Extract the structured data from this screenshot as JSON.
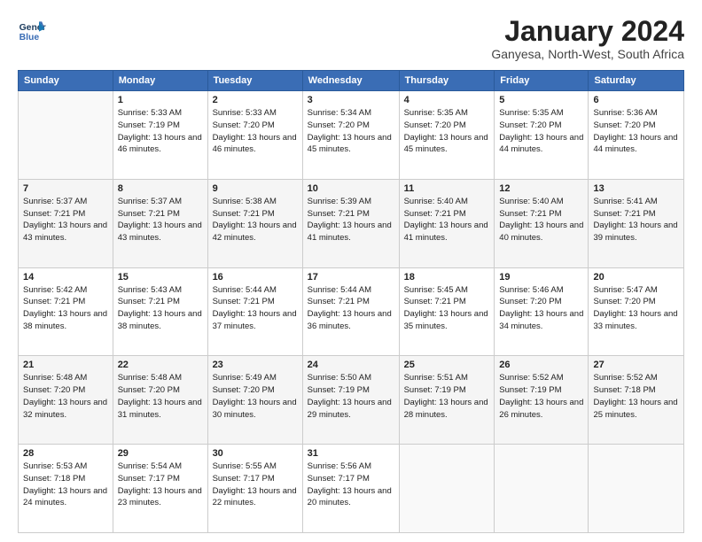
{
  "header": {
    "logo_line1": "General",
    "logo_line2": "Blue",
    "month": "January 2024",
    "location": "Ganyesa, North-West, South Africa"
  },
  "days_of_week": [
    "Sunday",
    "Monday",
    "Tuesday",
    "Wednesday",
    "Thursday",
    "Friday",
    "Saturday"
  ],
  "weeks": [
    [
      {
        "num": "",
        "sunrise": "",
        "sunset": "",
        "daylight": ""
      },
      {
        "num": "1",
        "sunrise": "Sunrise: 5:33 AM",
        "sunset": "Sunset: 7:19 PM",
        "daylight": "Daylight: 13 hours and 46 minutes."
      },
      {
        "num": "2",
        "sunrise": "Sunrise: 5:33 AM",
        "sunset": "Sunset: 7:20 PM",
        "daylight": "Daylight: 13 hours and 46 minutes."
      },
      {
        "num": "3",
        "sunrise": "Sunrise: 5:34 AM",
        "sunset": "Sunset: 7:20 PM",
        "daylight": "Daylight: 13 hours and 45 minutes."
      },
      {
        "num": "4",
        "sunrise": "Sunrise: 5:35 AM",
        "sunset": "Sunset: 7:20 PM",
        "daylight": "Daylight: 13 hours and 45 minutes."
      },
      {
        "num": "5",
        "sunrise": "Sunrise: 5:35 AM",
        "sunset": "Sunset: 7:20 PM",
        "daylight": "Daylight: 13 hours and 44 minutes."
      },
      {
        "num": "6",
        "sunrise": "Sunrise: 5:36 AM",
        "sunset": "Sunset: 7:20 PM",
        "daylight": "Daylight: 13 hours and 44 minutes."
      }
    ],
    [
      {
        "num": "7",
        "sunrise": "Sunrise: 5:37 AM",
        "sunset": "Sunset: 7:21 PM",
        "daylight": "Daylight: 13 hours and 43 minutes."
      },
      {
        "num": "8",
        "sunrise": "Sunrise: 5:37 AM",
        "sunset": "Sunset: 7:21 PM",
        "daylight": "Daylight: 13 hours and 43 minutes."
      },
      {
        "num": "9",
        "sunrise": "Sunrise: 5:38 AM",
        "sunset": "Sunset: 7:21 PM",
        "daylight": "Daylight: 13 hours and 42 minutes."
      },
      {
        "num": "10",
        "sunrise": "Sunrise: 5:39 AM",
        "sunset": "Sunset: 7:21 PM",
        "daylight": "Daylight: 13 hours and 41 minutes."
      },
      {
        "num": "11",
        "sunrise": "Sunrise: 5:40 AM",
        "sunset": "Sunset: 7:21 PM",
        "daylight": "Daylight: 13 hours and 41 minutes."
      },
      {
        "num": "12",
        "sunrise": "Sunrise: 5:40 AM",
        "sunset": "Sunset: 7:21 PM",
        "daylight": "Daylight: 13 hours and 40 minutes."
      },
      {
        "num": "13",
        "sunrise": "Sunrise: 5:41 AM",
        "sunset": "Sunset: 7:21 PM",
        "daylight": "Daylight: 13 hours and 39 minutes."
      }
    ],
    [
      {
        "num": "14",
        "sunrise": "Sunrise: 5:42 AM",
        "sunset": "Sunset: 7:21 PM",
        "daylight": "Daylight: 13 hours and 38 minutes."
      },
      {
        "num": "15",
        "sunrise": "Sunrise: 5:43 AM",
        "sunset": "Sunset: 7:21 PM",
        "daylight": "Daylight: 13 hours and 38 minutes."
      },
      {
        "num": "16",
        "sunrise": "Sunrise: 5:44 AM",
        "sunset": "Sunset: 7:21 PM",
        "daylight": "Daylight: 13 hours and 37 minutes."
      },
      {
        "num": "17",
        "sunrise": "Sunrise: 5:44 AM",
        "sunset": "Sunset: 7:21 PM",
        "daylight": "Daylight: 13 hours and 36 minutes."
      },
      {
        "num": "18",
        "sunrise": "Sunrise: 5:45 AM",
        "sunset": "Sunset: 7:21 PM",
        "daylight": "Daylight: 13 hours and 35 minutes."
      },
      {
        "num": "19",
        "sunrise": "Sunrise: 5:46 AM",
        "sunset": "Sunset: 7:20 PM",
        "daylight": "Daylight: 13 hours and 34 minutes."
      },
      {
        "num": "20",
        "sunrise": "Sunrise: 5:47 AM",
        "sunset": "Sunset: 7:20 PM",
        "daylight": "Daylight: 13 hours and 33 minutes."
      }
    ],
    [
      {
        "num": "21",
        "sunrise": "Sunrise: 5:48 AM",
        "sunset": "Sunset: 7:20 PM",
        "daylight": "Daylight: 13 hours and 32 minutes."
      },
      {
        "num": "22",
        "sunrise": "Sunrise: 5:48 AM",
        "sunset": "Sunset: 7:20 PM",
        "daylight": "Daylight: 13 hours and 31 minutes."
      },
      {
        "num": "23",
        "sunrise": "Sunrise: 5:49 AM",
        "sunset": "Sunset: 7:20 PM",
        "daylight": "Daylight: 13 hours and 30 minutes."
      },
      {
        "num": "24",
        "sunrise": "Sunrise: 5:50 AM",
        "sunset": "Sunset: 7:19 PM",
        "daylight": "Daylight: 13 hours and 29 minutes."
      },
      {
        "num": "25",
        "sunrise": "Sunrise: 5:51 AM",
        "sunset": "Sunset: 7:19 PM",
        "daylight": "Daylight: 13 hours and 28 minutes."
      },
      {
        "num": "26",
        "sunrise": "Sunrise: 5:52 AM",
        "sunset": "Sunset: 7:19 PM",
        "daylight": "Daylight: 13 hours and 26 minutes."
      },
      {
        "num": "27",
        "sunrise": "Sunrise: 5:52 AM",
        "sunset": "Sunset: 7:18 PM",
        "daylight": "Daylight: 13 hours and 25 minutes."
      }
    ],
    [
      {
        "num": "28",
        "sunrise": "Sunrise: 5:53 AM",
        "sunset": "Sunset: 7:18 PM",
        "daylight": "Daylight: 13 hours and 24 minutes."
      },
      {
        "num": "29",
        "sunrise": "Sunrise: 5:54 AM",
        "sunset": "Sunset: 7:17 PM",
        "daylight": "Daylight: 13 hours and 23 minutes."
      },
      {
        "num": "30",
        "sunrise": "Sunrise: 5:55 AM",
        "sunset": "Sunset: 7:17 PM",
        "daylight": "Daylight: 13 hours and 22 minutes."
      },
      {
        "num": "31",
        "sunrise": "Sunrise: 5:56 AM",
        "sunset": "Sunset: 7:17 PM",
        "daylight": "Daylight: 13 hours and 20 minutes."
      },
      {
        "num": "",
        "sunrise": "",
        "sunset": "",
        "daylight": ""
      },
      {
        "num": "",
        "sunrise": "",
        "sunset": "",
        "daylight": ""
      },
      {
        "num": "",
        "sunrise": "",
        "sunset": "",
        "daylight": ""
      }
    ]
  ]
}
